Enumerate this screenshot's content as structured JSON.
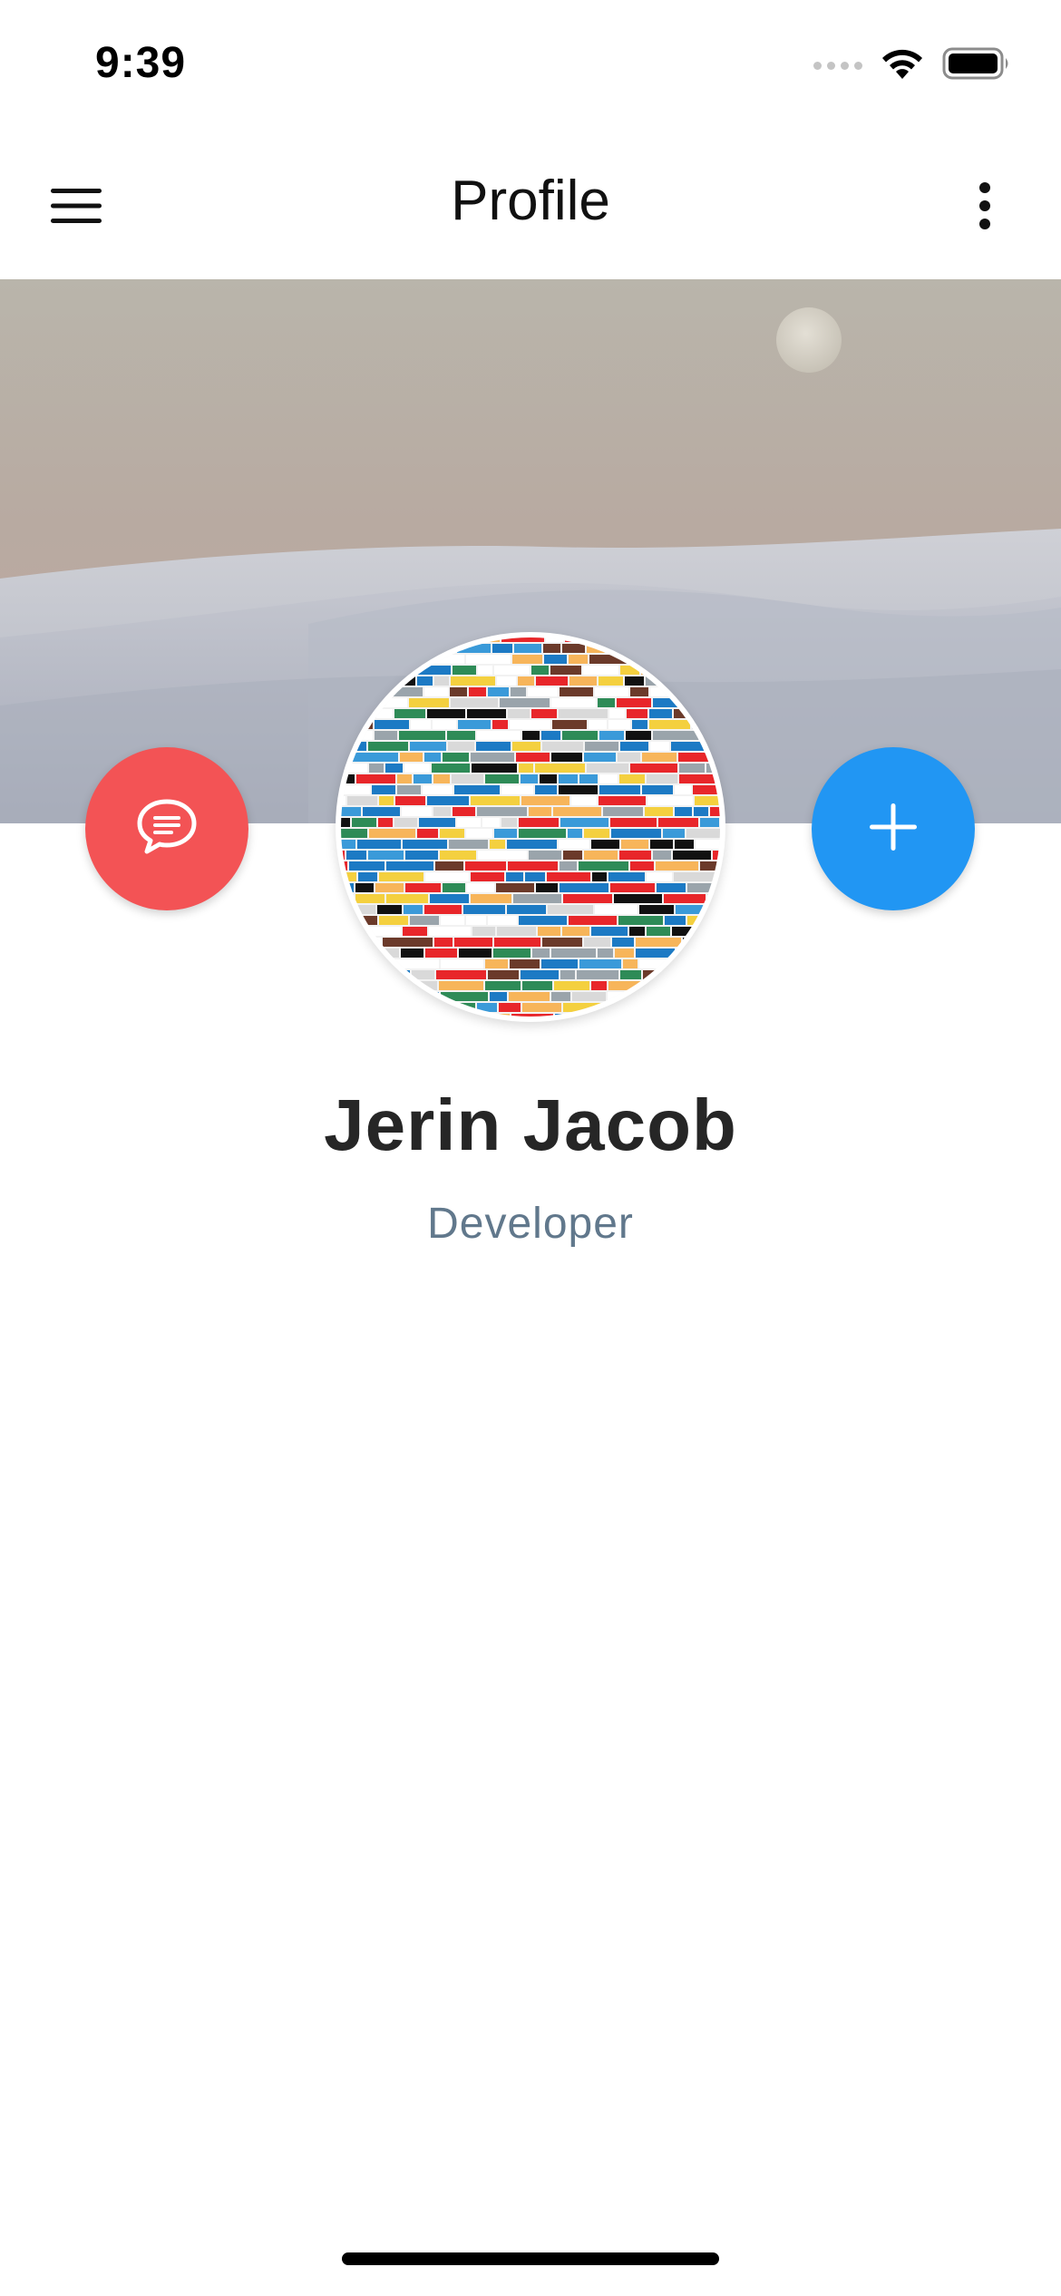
{
  "status_bar": {
    "time": "9:39"
  },
  "app_bar": {
    "title": "Profile",
    "menu_icon": "hamburger-menu-icon",
    "more_icon": "more-vertical-icon"
  },
  "profile": {
    "name": "Jerin Jacob",
    "role": "Developer"
  },
  "actions": {
    "chat_icon": "chat-bubble-icon",
    "add_icon": "plus-icon"
  },
  "colors": {
    "chat_fab": "#f35355",
    "add_fab": "#2196f3",
    "name_text": "#262626",
    "role_text": "#61788c"
  }
}
